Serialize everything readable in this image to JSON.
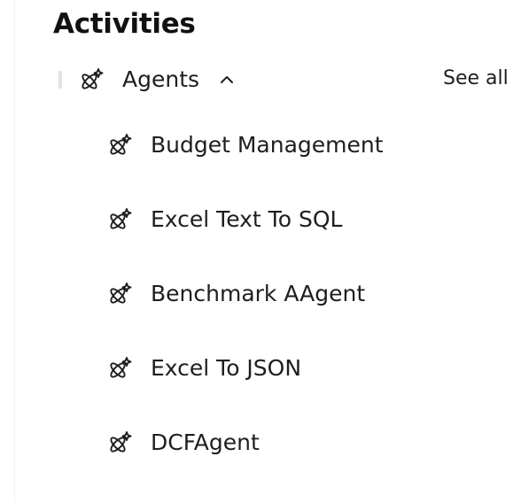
{
  "section": {
    "title": "Activities"
  },
  "group": {
    "label": "Agents",
    "icon": "agent-icon",
    "expanded": true,
    "see_all_label": "See all"
  },
  "items": [
    {
      "label": "Budget Management",
      "icon": "agent-icon"
    },
    {
      "label": "Excel Text To SQL",
      "icon": "agent-icon"
    },
    {
      "label": "Benchmark AAgent",
      "icon": "agent-icon"
    },
    {
      "label": "Excel To JSON",
      "icon": "agent-icon"
    },
    {
      "label": "DCFAgent",
      "icon": "agent-icon"
    }
  ],
  "colors": {
    "text": "#1e1e1e",
    "divider": "#e2e2e2",
    "background": "#ffffff"
  }
}
